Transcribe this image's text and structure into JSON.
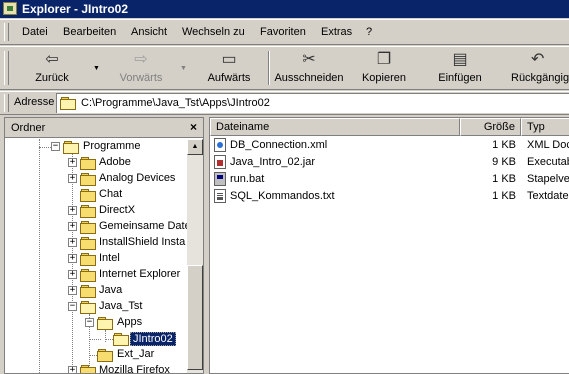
{
  "window": {
    "title": "Explorer - JIntro02",
    "app_icon": "explorer-icon"
  },
  "menu": {
    "items": [
      {
        "label": "Datei"
      },
      {
        "label": "Bearbeiten"
      },
      {
        "label": "Ansicht"
      },
      {
        "label": "Wechseln zu"
      },
      {
        "label": "Favoriten"
      },
      {
        "label": "Extras"
      },
      {
        "label": "?"
      }
    ]
  },
  "toolbar": {
    "back": {
      "label": "Zurück",
      "icon": "back-arrow-icon"
    },
    "forward": {
      "label": "Vorwärts",
      "icon": "forward-arrow-icon"
    },
    "up": {
      "label": "Aufwärts",
      "icon": "up-folder-icon"
    },
    "cut": {
      "label": "Ausschneiden",
      "icon": "scissors-icon"
    },
    "copy": {
      "label": "Kopieren",
      "icon": "copy-icon"
    },
    "paste": {
      "label": "Einfügen",
      "icon": "paste-icon"
    },
    "undo": {
      "label": "Rückgängig",
      "icon": "undo-icon"
    }
  },
  "address": {
    "label": "Adresse",
    "value": "C:\\Programme\\Java_Tst\\Apps\\JIntro02"
  },
  "tree": {
    "header": "Ordner",
    "close_glyph": "×",
    "items": [
      {
        "label": "Programme",
        "expander": "−"
      },
      {
        "label": "Adobe",
        "expander": "+"
      },
      {
        "label": "Analog Devices",
        "expander": "+"
      },
      {
        "label": "Chat",
        "expander": ""
      },
      {
        "label": "DirectX",
        "expander": "+"
      },
      {
        "label": "Gemeinsame Date",
        "expander": "+"
      },
      {
        "label": "InstallShield Insta",
        "expander": "+"
      },
      {
        "label": "Intel",
        "expander": "+"
      },
      {
        "label": "Internet Explorer",
        "expander": "+"
      },
      {
        "label": "Java",
        "expander": "+"
      },
      {
        "label": "Java_Tst",
        "expander": "−"
      },
      {
        "label": "Apps",
        "expander": "−"
      },
      {
        "label": "JIntro02",
        "expander": ""
      },
      {
        "label": "Ext_Jar",
        "expander": ""
      },
      {
        "label": "Mozilla Firefox",
        "expander": "+"
      }
    ]
  },
  "list": {
    "columns": {
      "name": "Dateiname",
      "size": "Größe",
      "type": "Typ"
    },
    "files": [
      {
        "name": "DB_Connection.xml",
        "size": "1 KB",
        "type": "XML Doc",
        "icon": "xml-file-icon"
      },
      {
        "name": "Java_Intro_02.jar",
        "size": "9 KB",
        "type": "Executab",
        "icon": "jar-file-icon"
      },
      {
        "name": "run.bat",
        "size": "1 KB",
        "type": "Stapelve",
        "icon": "bat-file-icon"
      },
      {
        "name": "SQL_Kommandos.txt",
        "size": "1 KB",
        "type": "Textdate",
        "icon": "txt-file-icon"
      }
    ]
  }
}
